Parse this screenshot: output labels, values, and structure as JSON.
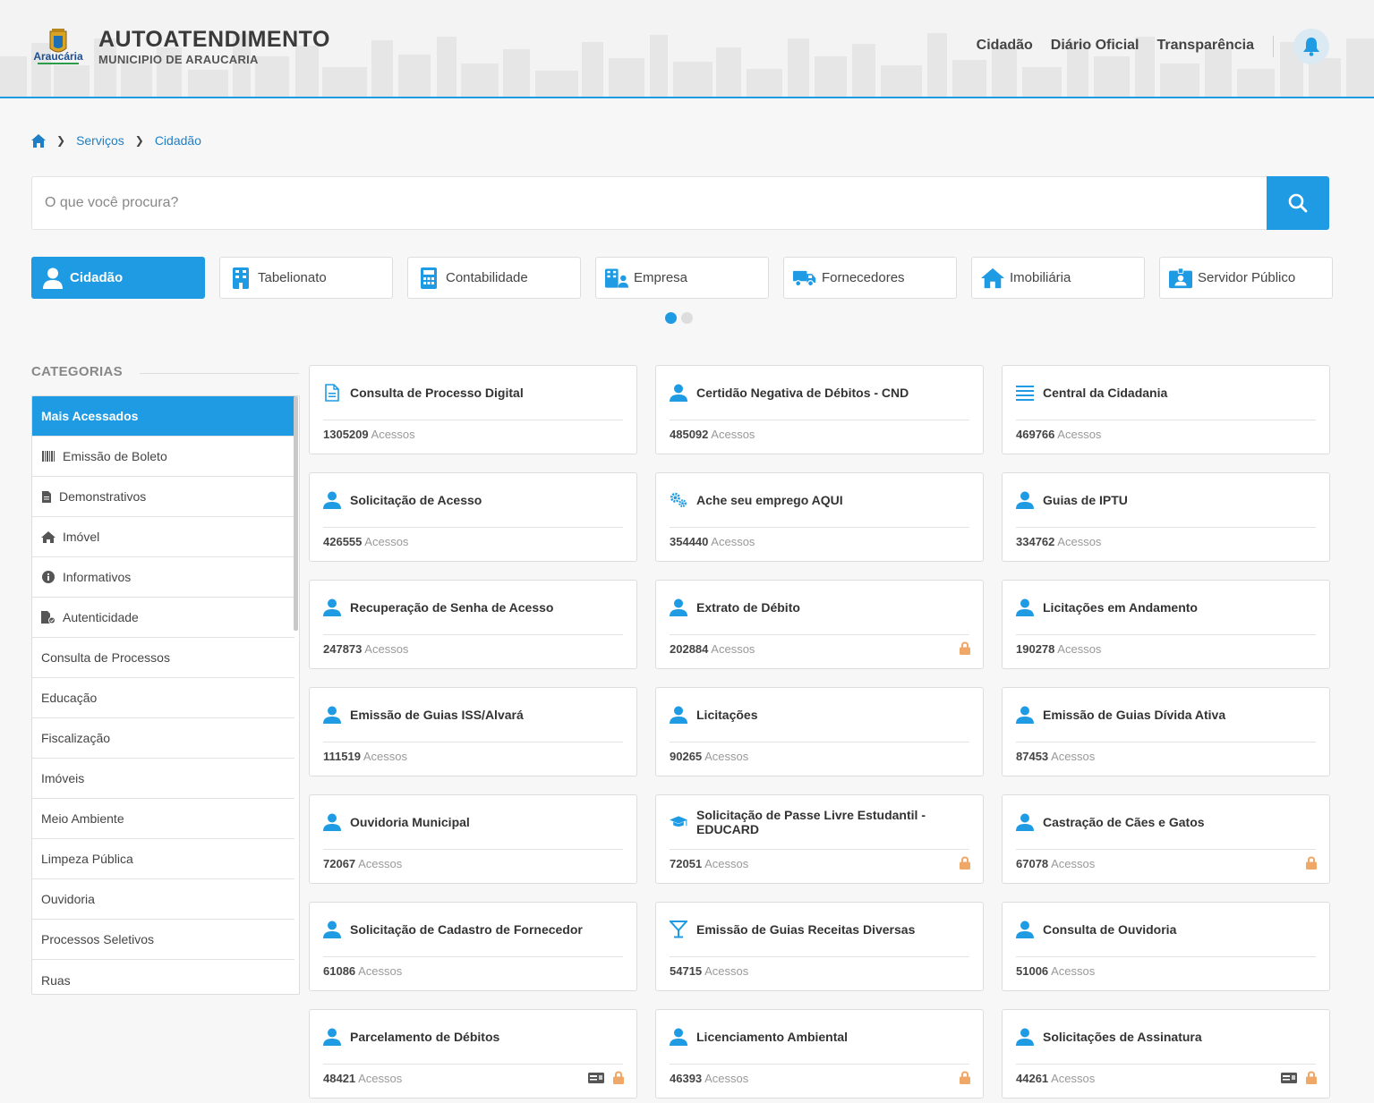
{
  "header": {
    "logo_text": "Araucária",
    "title": "AUTOATENDIMENTO",
    "subtitle": "MUNICIPIO DE ARAUCARIA",
    "nav": [
      "Cidadão",
      "Diário Oficial",
      "Transparência"
    ]
  },
  "breadcrumb": [
    "Serviços",
    "Cidadão"
  ],
  "search": {
    "placeholder": "O que você procura?"
  },
  "profiles": [
    {
      "label": "Cidadão",
      "icon": "user-icon",
      "active": true
    },
    {
      "label": "Tabelionato",
      "icon": "building-icon"
    },
    {
      "label": "Contabilidade",
      "icon": "calculator-icon"
    },
    {
      "label": "Empresa",
      "icon": "company-icon"
    },
    {
      "label": "Fornecedores",
      "icon": "truck-icon"
    },
    {
      "label": "Imobiliária",
      "icon": "home-icon"
    },
    {
      "label": "Servidor Público",
      "icon": "id-badge-icon"
    }
  ],
  "categories": {
    "title": "CATEGORIAS",
    "items": [
      {
        "label": "Mais Acessados",
        "active": true
      },
      {
        "label": "Emissão de Boleto",
        "icon": "barcode-icon"
      },
      {
        "label": "Demonstrativos",
        "icon": "file-icon"
      },
      {
        "label": "Imóvel",
        "icon": "home-icon"
      },
      {
        "label": "Informativos",
        "icon": "info-icon"
      },
      {
        "label": "Autenticidade",
        "icon": "file-check-icon"
      },
      {
        "label": "Consulta de Processos"
      },
      {
        "label": "Educação"
      },
      {
        "label": "Fiscalização"
      },
      {
        "label": "Imóveis"
      },
      {
        "label": "Meio Ambiente"
      },
      {
        "label": "Limpeza Pública"
      },
      {
        "label": "Ouvidoria"
      },
      {
        "label": "Processos Seletivos"
      },
      {
        "label": "Ruas"
      }
    ]
  },
  "access_label": "Acessos",
  "services": [
    {
      "title": "Consulta de Processo Digital",
      "count": "1305209",
      "icon": "document-icon"
    },
    {
      "title": "Certidão Negativa de Débitos - CND",
      "count": "485092",
      "icon": "user-icon"
    },
    {
      "title": "Central da Cidadania",
      "count": "469766",
      "icon": "list-icon"
    },
    {
      "title": "Solicitação de Acesso",
      "count": "426555",
      "icon": "user-icon"
    },
    {
      "title": "Ache seu emprego AQUI",
      "count": "354440",
      "icon": "gears-icon"
    },
    {
      "title": "Guias de IPTU",
      "count": "334762",
      "icon": "user-icon"
    },
    {
      "title": "Recuperação de Senha de Acesso",
      "count": "247873",
      "icon": "user-icon"
    },
    {
      "title": "Extrato de Débito",
      "count": "202884",
      "icon": "user-icon",
      "lock": true
    },
    {
      "title": "Licitações em Andamento",
      "count": "190278",
      "icon": "user-icon"
    },
    {
      "title": "Emissão de Guias ISS/Alvará",
      "count": "111519",
      "icon": "user-icon"
    },
    {
      "title": "Licitações",
      "count": "90265",
      "icon": "user-icon"
    },
    {
      "title": "Emissão de Guias Dívida Ativa",
      "count": "87453",
      "icon": "user-icon"
    },
    {
      "title": "Ouvidoria Municipal",
      "count": "72067",
      "icon": "user-icon"
    },
    {
      "title": "Solicitação de Passe Livre Estudantil - EDUCARD",
      "count": "72051",
      "icon": "graduation-cap-icon",
      "lock": true
    },
    {
      "title": "Castração de Cães e Gatos",
      "count": "67078",
      "icon": "user-icon",
      "lock": true
    },
    {
      "title": "Solicitação de Cadastro de Fornecedor",
      "count": "61086",
      "icon": "user-icon"
    },
    {
      "title": "Emissão de Guias Receitas Diversas",
      "count": "54715",
      "icon": "cocktail-icon"
    },
    {
      "title": "Consulta de Ouvidoria",
      "count": "51006",
      "icon": "user-icon"
    },
    {
      "title": "Parcelamento de Débitos",
      "count": "48421",
      "icon": "user-icon",
      "card": true,
      "lock": true
    },
    {
      "title": "Licenciamento Ambiental",
      "count": "46393",
      "icon": "user-icon",
      "lock": true
    },
    {
      "title": "Solicitações de Assinatura",
      "count": "44261",
      "icon": "user-icon",
      "card": true,
      "lock": true
    }
  ],
  "colors": {
    "accent": "#1e9be3",
    "lock": "#f0a868"
  }
}
